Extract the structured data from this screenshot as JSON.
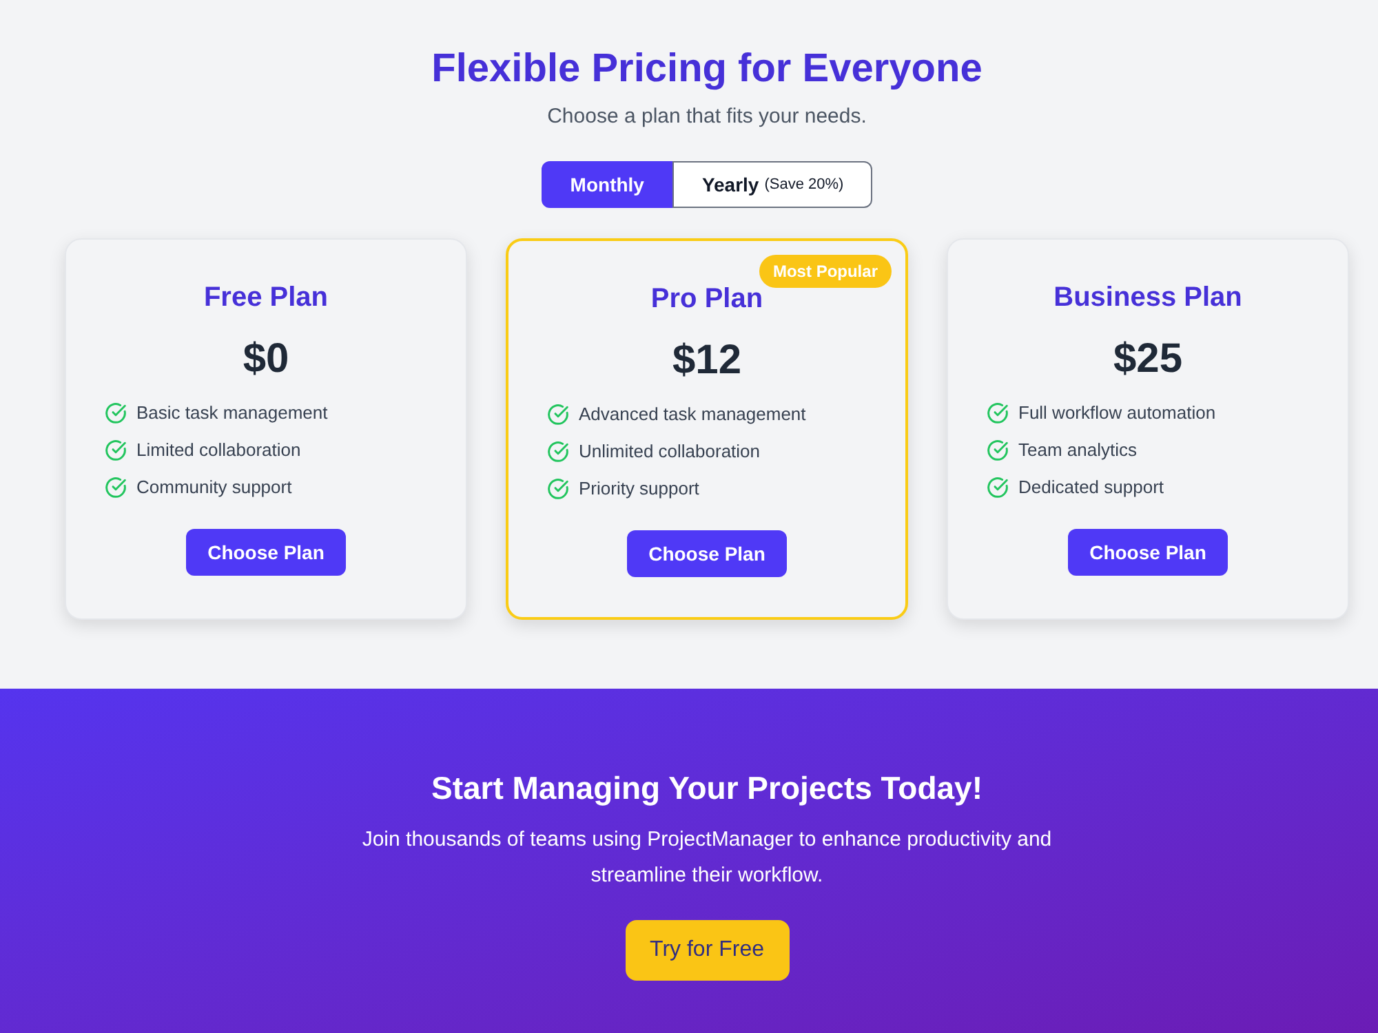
{
  "header": {
    "title": "Flexible Pricing for Everyone",
    "subtitle": "Choose a plan that fits your needs."
  },
  "billing_toggle": [
    {
      "label": "Monthly",
      "selected": true
    },
    {
      "label": "Yearly",
      "note": "(Save 20%)",
      "selected": false
    }
  ],
  "plans": [
    {
      "name": "Free Plan",
      "price": "$0",
      "highlighted": false,
      "features": [
        "Basic task management",
        "Limited collaboration",
        "Community support"
      ],
      "button": "Choose Plan"
    },
    {
      "name": "Pro Plan",
      "badge": "Most Popular",
      "price": "$12",
      "highlighted": true,
      "features": [
        "Advanced task management",
        "Unlimited collaboration",
        "Priority support"
      ],
      "button": "Choose Plan"
    },
    {
      "name": "Business Plan",
      "price": "$25",
      "highlighted": false,
      "features": [
        "Full workflow automation",
        "Team analytics",
        "Dedicated support"
      ],
      "button": "Choose Plan"
    }
  ],
  "cta": {
    "title": "Start Managing Your Projects Today!",
    "text": "Join thousands of teams using ProjectManager to enhance productivity and streamline their workflow.",
    "button": "Try for Free"
  }
}
